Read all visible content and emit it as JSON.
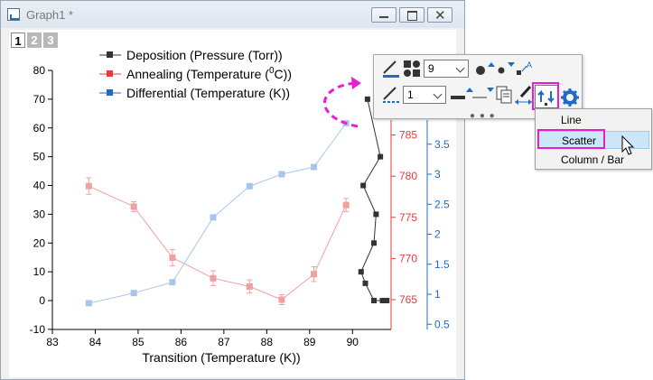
{
  "window": {
    "title": "Graph1 *"
  },
  "layers": [
    "1",
    "2",
    "3"
  ],
  "legend": [
    {
      "label": "Deposition (Pressure (Torr))",
      "color": "#333333"
    },
    {
      "label": "Annealing (Temperature (",
      "sup": "0",
      "tail": "C))",
      "color": "#e53b3b"
    },
    {
      "label": "Differential (Temperature (K))",
      "color": "#1f6bc4"
    }
  ],
  "axes": {
    "xlabel": "Transition (Temperature (K))",
    "x_ticks": [
      "83",
      "84",
      "85",
      "86",
      "87",
      "88",
      "89",
      "90"
    ],
    "y_left_ticks": [
      "-10",
      "0",
      "10",
      "20",
      "30",
      "40",
      "50",
      "60",
      "70",
      "80"
    ],
    "y_red_ticks": [
      "765",
      "770",
      "775",
      "780",
      "785"
    ],
    "y_blue_ticks": [
      "0.5",
      "1",
      "1.5",
      "2",
      "2.5",
      "3",
      "3.5"
    ]
  },
  "chart_data": {
    "type": "line",
    "x_range": [
      83,
      90.9
    ],
    "series": [
      {
        "name": "Deposition (Pressure (Torr))",
        "axis": "left",
        "color": "#333333",
        "points": [
          [
            90.35,
            70
          ],
          [
            90.65,
            50
          ],
          [
            90.25,
            40
          ],
          [
            90.55,
            30
          ],
          [
            90.5,
            20
          ],
          [
            90.2,
            10
          ],
          [
            90.3,
            6
          ],
          [
            90.5,
            0
          ],
          [
            90.7,
            0
          ],
          [
            90.8,
            0
          ]
        ]
      },
      {
        "name": "Annealing (Temperature (0C))",
        "axis": "right1",
        "color": "#f0a0a0",
        "x": [
          83.85,
          84.9,
          85.8,
          86.75,
          87.6,
          88.35,
          89.1,
          89.85
        ],
        "values": [
          778.8,
          776.3,
          770.1,
          767.6,
          766.6,
          765.0,
          768.1,
          776.5
        ],
        "errors": [
          1.0,
          0.6,
          1.0,
          0.9,
          0.8,
          0.6,
          0.9,
          0.8
        ]
      },
      {
        "name": "Differential (Temperature (K))",
        "axis": "right2",
        "color": "#a8c6ec",
        "x": [
          83.85,
          84.9,
          85.8,
          86.75,
          87.6,
          88.35,
          89.1,
          89.85
        ],
        "values": [
          0.85,
          1.02,
          1.2,
          2.28,
          2.8,
          3.0,
          3.12,
          3.85
        ]
      }
    ]
  },
  "toolbar": {
    "symbol_size": "9",
    "line_width": "1"
  },
  "menu": {
    "items": [
      "Line",
      "Scatter",
      "Column / Bar"
    ],
    "highlighted": "Scatter"
  },
  "colors": {
    "highlight": "#ea1bd5",
    "accent": "#1f6bc4",
    "red_axis": "#e53b3b"
  }
}
